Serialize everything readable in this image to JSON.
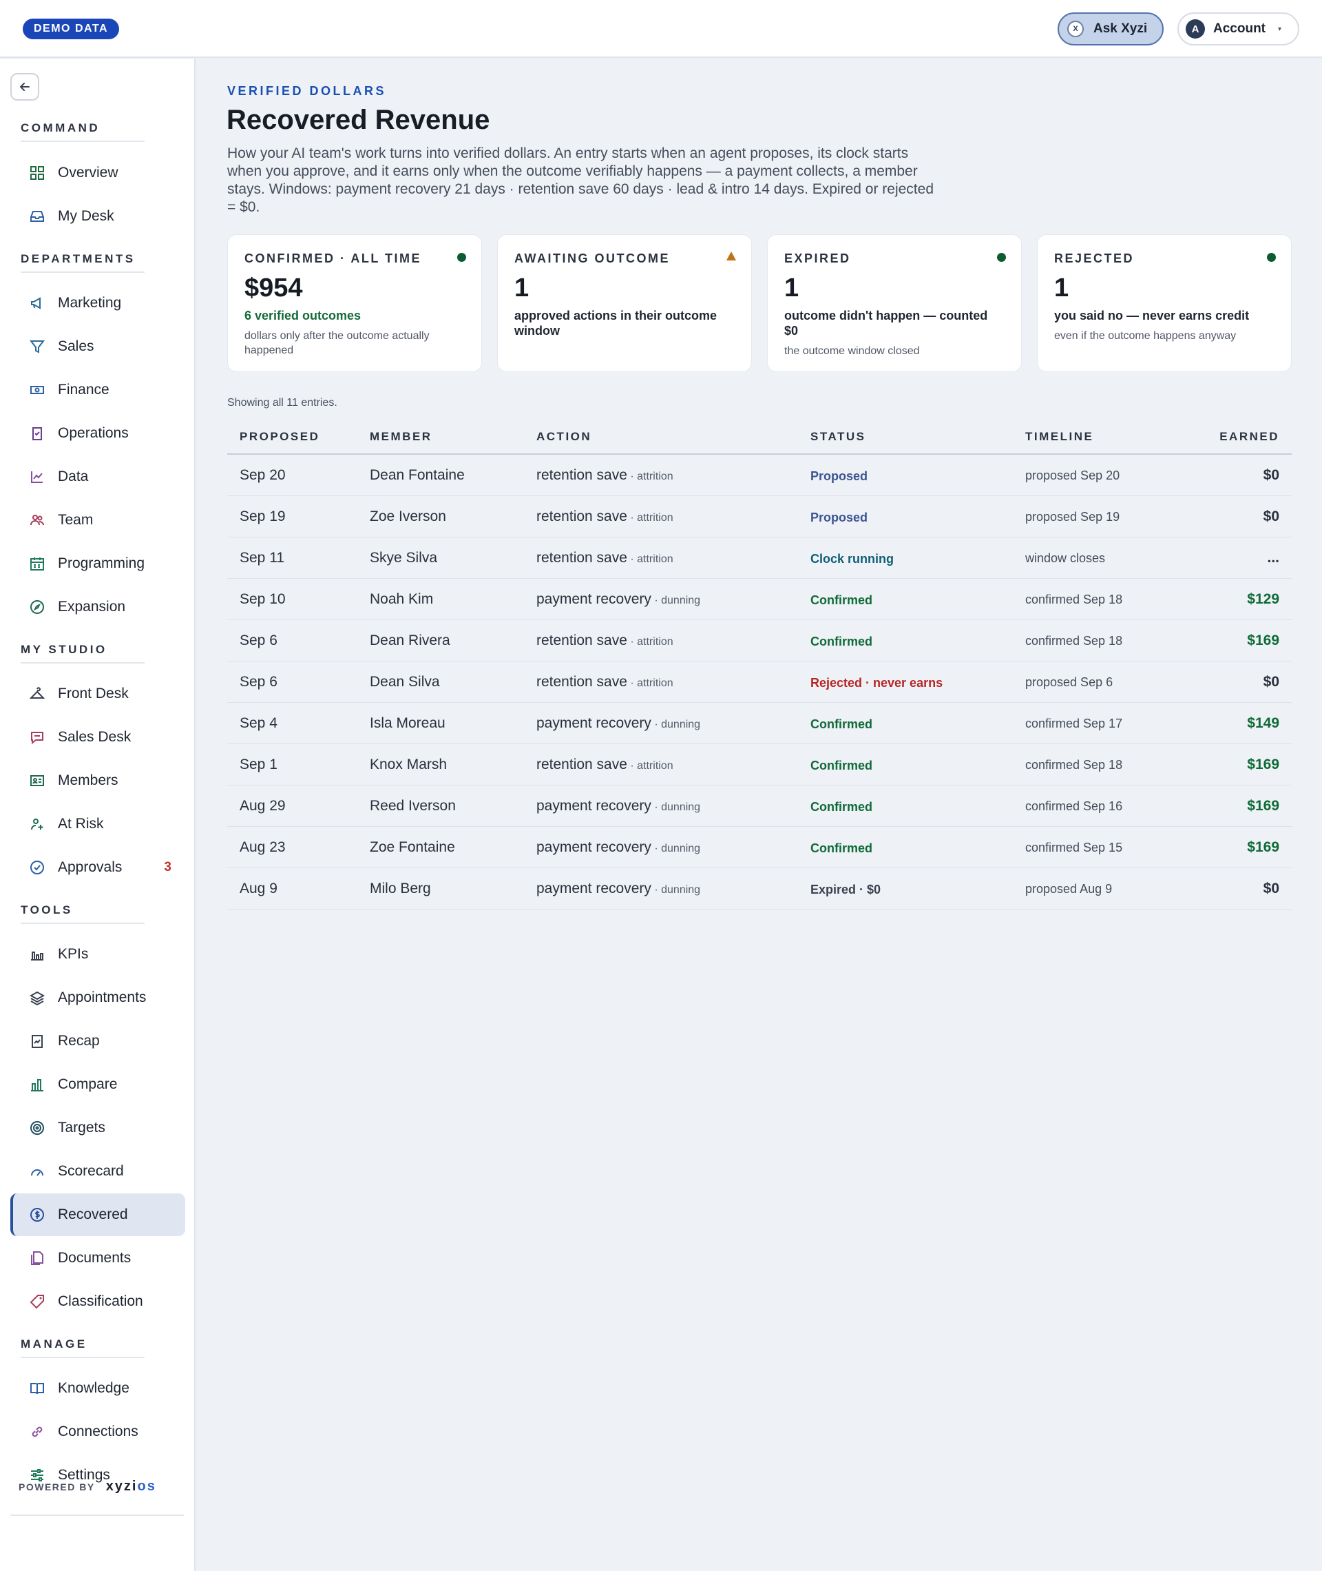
{
  "topbar": {
    "demo_badge": "DEMO DATA",
    "ask_label": "Ask Xyzi",
    "ask_icon_text": "X",
    "account_label": "Account",
    "account_avatar": "A"
  },
  "sidebar": {
    "sections": {
      "command": "COMMAND",
      "departments": "DEPARTMENTS",
      "my_studio": "MY STUDIO",
      "tools": "TOOLS",
      "manage": "MANAGE"
    },
    "items": {
      "overview": "Overview",
      "my_desk": "My Desk",
      "marketing": "Marketing",
      "sales": "Sales",
      "finance": "Finance",
      "operations": "Operations",
      "data": "Data",
      "team": "Team",
      "programming": "Programming",
      "expansion": "Expansion",
      "front_desk": "Front Desk",
      "sales_desk": "Sales Desk",
      "members": "Members",
      "at_risk": "At Risk",
      "approvals": "Approvals",
      "approvals_badge": "3",
      "kpis": "KPIs",
      "appointments": "Appointments",
      "recap": "Recap",
      "compare": "Compare",
      "targets": "Targets",
      "scorecard": "Scorecard",
      "recovered": "Recovered",
      "documents": "Documents",
      "classification": "Classification",
      "knowledge": "Knowledge",
      "connections": "Connections",
      "settings": "Settings"
    },
    "powered_by": "POWERED BY",
    "logo_main": "xyzi",
    "logo_accent": "os"
  },
  "header": {
    "eyebrow": "VERIFIED DOLLARS",
    "title": "Recovered Revenue",
    "description": "How your AI team's work turns into verified dollars. An entry starts when an agent proposes, its clock starts when you approve, and it earns only when the outcome verifiably happens — a payment collects, a member stays. Windows: payment recovery 21 days · retention save 60 days · lead & intro 14 days. Expired or rejected = $0."
  },
  "cards": {
    "confirmed": {
      "title": "CONFIRMED · ALL TIME",
      "value": "$954",
      "sub": "6 verified outcomes",
      "note": "dollars only after the outcome actually happened"
    },
    "awaiting": {
      "title": "AWAITING OUTCOME",
      "value": "1",
      "sub": "approved actions in their outcome window",
      "note": ""
    },
    "expired": {
      "title": "EXPIRED",
      "value": "1",
      "sub": "outcome didn't happen — counted $0",
      "note": "the outcome window closed"
    },
    "rejected": {
      "title": "REJECTED",
      "value": "1",
      "sub": "you said no — never earns credit",
      "note": "even if the outcome happens anyway"
    }
  },
  "table": {
    "showing": "Showing all 11 entries.",
    "headers": {
      "proposed": "PROPOSED",
      "member": "MEMBER",
      "action": "ACTION",
      "status": "STATUS",
      "timeline": "TIMELINE",
      "earned": "EARNED"
    },
    "rows": [
      {
        "proposed": "Sep 20",
        "member": "Dean Fontaine",
        "action": "retention save",
        "action_sub": " · attrition",
        "status": "Proposed",
        "status_kind": "proposed",
        "timeline": "proposed Sep 20",
        "earned": "$0"
      },
      {
        "proposed": "Sep 19",
        "member": "Zoe Iverson",
        "action": "retention save",
        "action_sub": " · attrition",
        "status": "Proposed",
        "status_kind": "proposed",
        "timeline": "proposed Sep 19",
        "earned": "$0"
      },
      {
        "proposed": "Sep 11",
        "member": "Skye Silva",
        "action": "retention save",
        "action_sub": " · attrition",
        "status": "Clock running",
        "status_kind": "clock",
        "timeline": "window closes",
        "earned": "..."
      },
      {
        "proposed": "Sep 10",
        "member": "Noah Kim",
        "action": "payment recovery",
        "action_sub": " · dunning",
        "status": "Confirmed",
        "status_kind": "confirmed",
        "timeline": "confirmed Sep 18",
        "earned": "$129"
      },
      {
        "proposed": "Sep 6",
        "member": "Dean Rivera",
        "action": "retention save",
        "action_sub": " · attrition",
        "status": "Confirmed",
        "status_kind": "confirmed",
        "timeline": "confirmed Sep 18",
        "earned": "$169"
      },
      {
        "proposed": "Sep 6",
        "member": "Dean Silva",
        "action": "retention save",
        "action_sub": " · attrition",
        "status": "Rejected · never earns",
        "status_kind": "rejected",
        "timeline": "proposed Sep 6",
        "earned": "$0"
      },
      {
        "proposed": "Sep 4",
        "member": "Isla Moreau",
        "action": "payment recovery",
        "action_sub": " · dunning",
        "status": "Confirmed",
        "status_kind": "confirmed",
        "timeline": "confirmed Sep 17",
        "earned": "$149"
      },
      {
        "proposed": "Sep 1",
        "member": "Knox Marsh",
        "action": "retention save",
        "action_sub": " · attrition",
        "status": "Confirmed",
        "status_kind": "confirmed",
        "timeline": "confirmed Sep 18",
        "earned": "$169"
      },
      {
        "proposed": "Aug 29",
        "member": "Reed Iverson",
        "action": "payment recovery",
        "action_sub": " · dunning",
        "status": "Confirmed",
        "status_kind": "confirmed",
        "timeline": "confirmed Sep 16",
        "earned": "$169"
      },
      {
        "proposed": "Aug 23",
        "member": "Zoe Fontaine",
        "action": "payment recovery",
        "action_sub": " · dunning",
        "status": "Confirmed",
        "status_kind": "confirmed",
        "timeline": "confirmed Sep 15",
        "earned": "$169"
      },
      {
        "proposed": "Aug 9",
        "member": "Milo Berg",
        "action": "payment recovery",
        "action_sub": " · dunning",
        "status": "Expired · $0",
        "status_kind": "expired",
        "timeline": "proposed Aug 9",
        "earned": "$0"
      }
    ]
  },
  "colors": {
    "accent": "#1a46b8",
    "confirmed": "#0f6a37",
    "rejected": "#b82424",
    "proposed": "#3c5492",
    "clock": "#0f5f75",
    "warning": "#c07214"
  }
}
